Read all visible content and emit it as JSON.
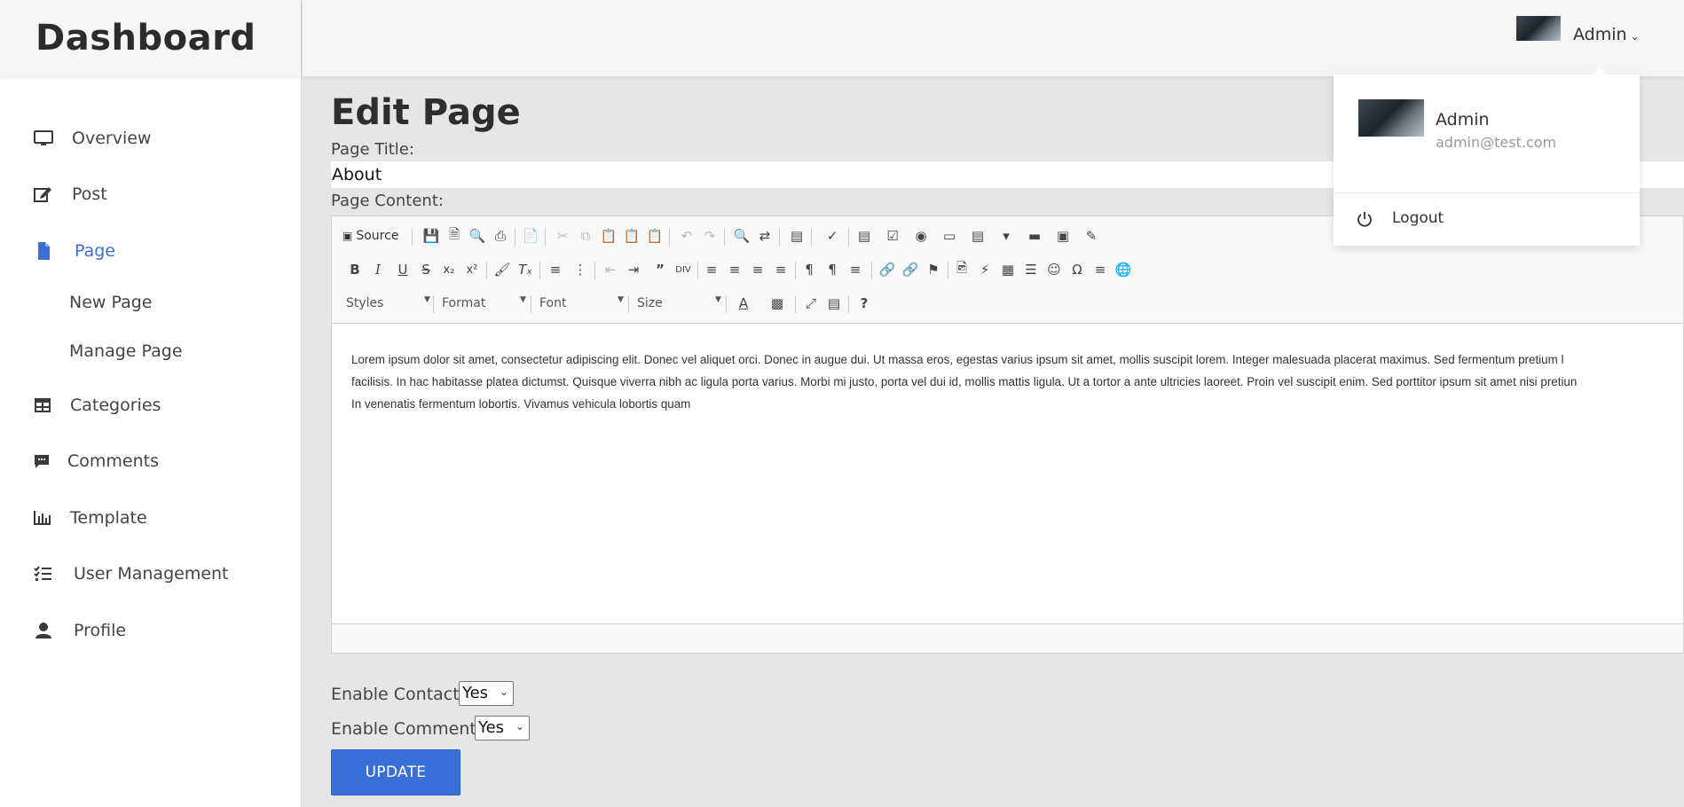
{
  "brand": {
    "title": "Dashboard"
  },
  "sidebar": {
    "items": [
      {
        "label": "Overview",
        "icon": "monitor-icon"
      },
      {
        "label": "Post",
        "icon": "edit-icon"
      },
      {
        "label": "Page",
        "icon": "file-icon",
        "active": true
      },
      {
        "label": "Categories",
        "icon": "table-icon"
      },
      {
        "label": "Comments",
        "icon": "comment-icon"
      },
      {
        "label": "Template",
        "icon": "bar-chart-icon"
      },
      {
        "label": "User Management",
        "icon": "checklist-icon"
      },
      {
        "label": "Profile",
        "icon": "user-icon"
      }
    ],
    "subitems": [
      {
        "label": "New Page"
      },
      {
        "label": "Manage Page"
      }
    ]
  },
  "topbar": {
    "user_name": "Admin"
  },
  "dropdown": {
    "name": "Admin",
    "email": "admin@test.com",
    "logout_label": "Logout"
  },
  "main": {
    "title": "Edit Page",
    "page_title_label": "Page Title:",
    "page_title_value": "About",
    "page_content_label": "Page Content:",
    "toolbar": {
      "source_label": "Source",
      "styles_label": "Styles",
      "format_label": "Format",
      "font_label": "Font",
      "size_label": "Size",
      "help_label": "?"
    },
    "content_lines": [
      "Lorem ipsum dolor sit amet, consectetur adipiscing elit. Donec vel aliquet orci. Donec in augue dui. Ut massa eros, egestas varius ipsum sit amet, mollis suscipit lorem. Integer malesuada placerat maximus. Sed fermentum pretium l",
      "facilisis. In hac habitasse platea dictumst. Quisque viverra nibh ac ligula porta varius. Morbi mi justo, porta vel dui id, mollis mattis ligula. Ut a tortor a ante ultricies laoreet. Proin vel suscipit enim. Sed porttitor ipsum sit amet nisi pretiun",
      "In venenatis fermentum lobortis. Vivamus vehicula lobortis quam"
    ],
    "enable_contact_label": "Enable Contact",
    "enable_contact_value": "Yes",
    "enable_comment_label": "Enable Comment",
    "enable_comment_value": "Yes",
    "update_label": "UPDATE"
  },
  "colors": {
    "accent": "#3a6fd8",
    "sidebar_bg": "#ffffff",
    "main_bg": "#e6e6e6"
  }
}
